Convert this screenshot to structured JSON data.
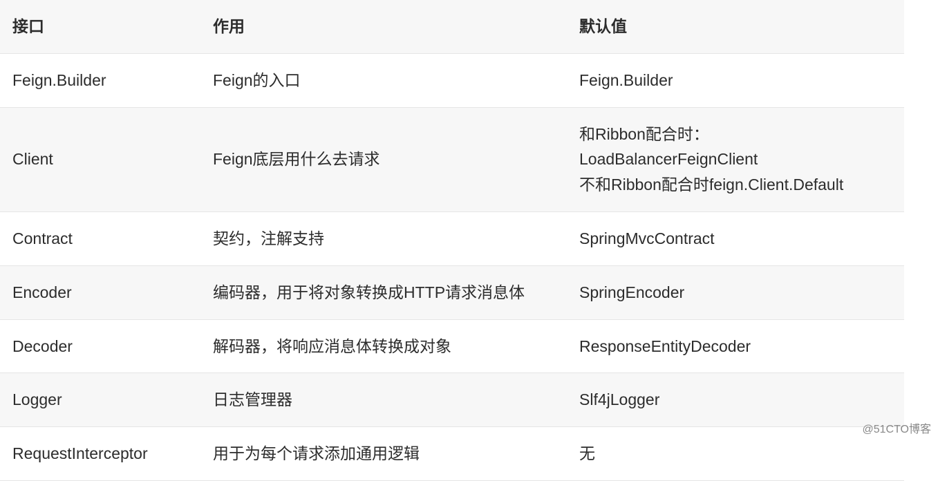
{
  "table": {
    "headers": {
      "interface": "接口",
      "purpose": "作用",
      "default": "默认值"
    },
    "rows": [
      {
        "interface": "Feign.Builder",
        "purpose": "Feign的入口",
        "default": "Feign.Builder"
      },
      {
        "interface": "Client",
        "purpose": "Feign底层用什么去请求",
        "default": "和Ribbon配合时：\nLoadBalancerFeignClient\n不和Ribbon配合时feign.Client.Default"
      },
      {
        "interface": "Contract",
        "purpose": "契约，注解支持",
        "default": "SpringMvcContract"
      },
      {
        "interface": "Encoder",
        "purpose": "编码器，用于将对象转换成HTTP请求消息体",
        "default": "SpringEncoder"
      },
      {
        "interface": "Decoder",
        "purpose": "解码器，将响应消息体转换成对象",
        "default": "ResponseEntityDecoder"
      },
      {
        "interface": "Logger",
        "purpose": "日志管理器",
        "default": "Slf4jLogger"
      },
      {
        "interface": "RequestInterceptor",
        "purpose": "用于为每个请求添加通用逻辑",
        "default": "无"
      }
    ]
  },
  "watermark": "@51CTO博客"
}
